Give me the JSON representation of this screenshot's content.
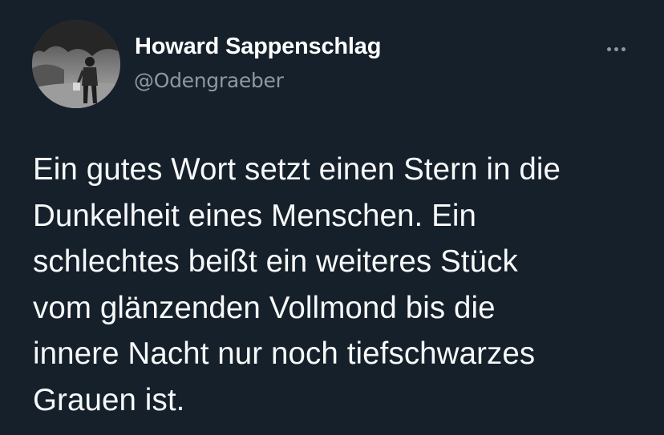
{
  "author": {
    "display_name": "Howard Sappenschlag",
    "handle": "@Odengraeber",
    "avatar_icon": "profile-photo-man-walking-with-bucket"
  },
  "menu": {
    "icon": "more-horizontal-icon"
  },
  "tweet": {
    "text": "Ein gutes Wort setzt einen Stern in die\nDunkelheit eines Menschen. Ein\nschlechtes beißt ein weiteres Stück\nvom glänzenden Vollmond bis die\ninnere Nacht nur noch tiefschwarzes\nGrauen ist."
  },
  "colors": {
    "background": "#15202b",
    "primary_text": "#f7f9f9",
    "secondary_text": "#8b98a5"
  }
}
